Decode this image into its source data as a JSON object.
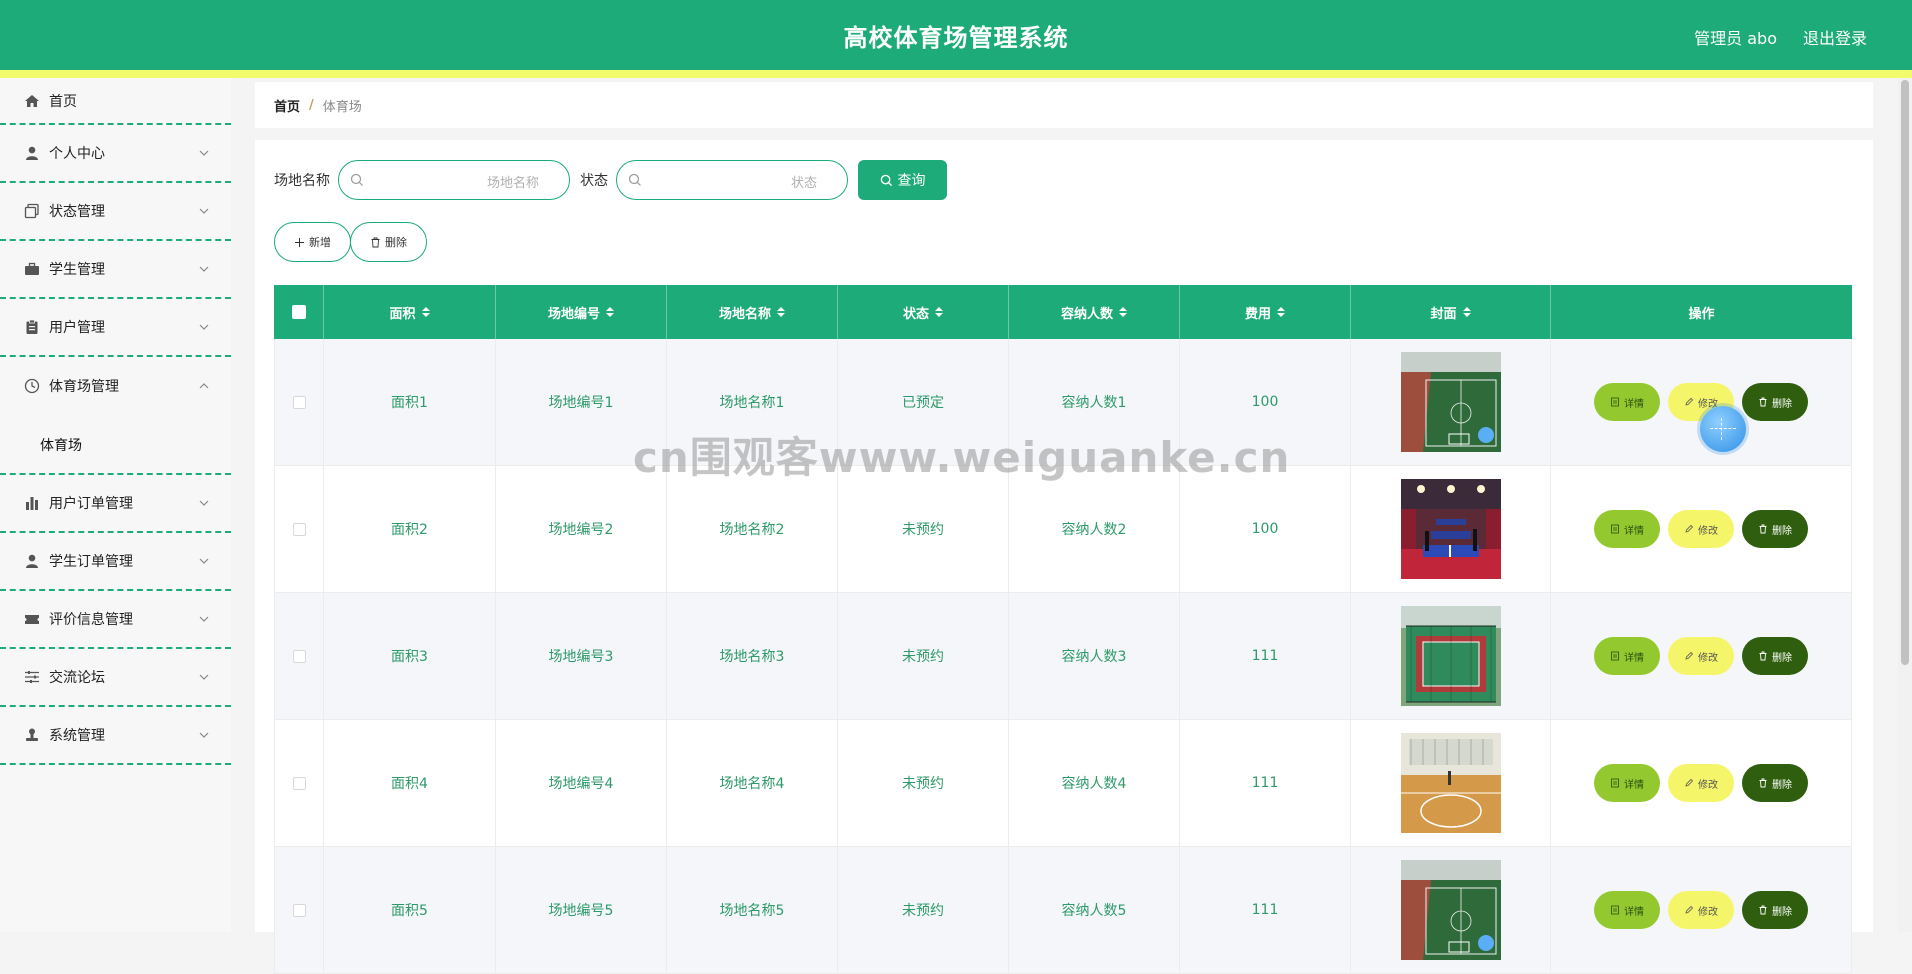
{
  "header": {
    "title": "高校体育场管理系统",
    "user": "管理员 abo",
    "logout": "退出登录"
  },
  "sidebar": {
    "items": [
      {
        "label": "首页",
        "icon": "home-icon"
      },
      {
        "label": "个人中心",
        "icon": "user-icon"
      },
      {
        "label": "状态管理",
        "icon": "copy-icon"
      },
      {
        "label": "学生管理",
        "icon": "briefcase-icon"
      },
      {
        "label": "用户管理",
        "icon": "clipboard-icon"
      },
      {
        "label": "体育场管理",
        "icon": "clock-icon",
        "expanded": true,
        "children": [
          {
            "label": "体育场"
          }
        ]
      },
      {
        "label": "用户订单管理",
        "icon": "bar-chart-icon"
      },
      {
        "label": "学生订单管理",
        "icon": "user-icon"
      },
      {
        "label": "评价信息管理",
        "icon": "ticket-icon"
      },
      {
        "label": "交流论坛",
        "icon": "sliders-icon"
      },
      {
        "label": "系统管理",
        "icon": "stamp-icon"
      }
    ]
  },
  "breadcrumb": {
    "home": "首页",
    "separator": "/",
    "current": "体育场"
  },
  "search": {
    "name_label": "场地名称",
    "name_placeholder": "场地名称",
    "status_label": "状态",
    "status_placeholder": "状态",
    "button": "查询"
  },
  "actions": {
    "add": "新增",
    "delete": "删除"
  },
  "table": {
    "headers": [
      "面积",
      "场地编号",
      "场地名称",
      "状态",
      "容纳人数",
      "费用",
      "封面",
      "操作"
    ],
    "rows": [
      {
        "area": "面积1",
        "code": "场地编号1",
        "name": "场地名称1",
        "status": "已预定",
        "capacity": "容纳人数1",
        "fee": "100",
        "cover": "football-field"
      },
      {
        "area": "面积2",
        "code": "场地编号2",
        "name": "场地名称2",
        "status": "未预约",
        "capacity": "容纳人数2",
        "fee": "100",
        "cover": "table-tennis-hall"
      },
      {
        "area": "面积3",
        "code": "场地编号3",
        "name": "场地名称3",
        "status": "未预约",
        "capacity": "容纳人数3",
        "fee": "111",
        "cover": "outdoor-court"
      },
      {
        "area": "面积4",
        "code": "场地编号4",
        "name": "场地名称4",
        "status": "未预约",
        "capacity": "容纳人数4",
        "fee": "111",
        "cover": "basketball-hall"
      },
      {
        "area": "面积5",
        "code": "场地编号5",
        "name": "场地名称5",
        "status": "未预约",
        "capacity": "容纳人数5",
        "fee": "111",
        "cover": "football-field"
      }
    ],
    "row_actions": {
      "detail": "详情",
      "edit": "修改",
      "delete": "删除"
    }
  },
  "watermark": "cn围观客www.weiguanke.cn",
  "colors": {
    "primary": "#1dab79",
    "stripe": "#f1fb6b",
    "detail": "#93c92f",
    "edit": "#f5f56a",
    "delete": "#2f5e0f"
  }
}
